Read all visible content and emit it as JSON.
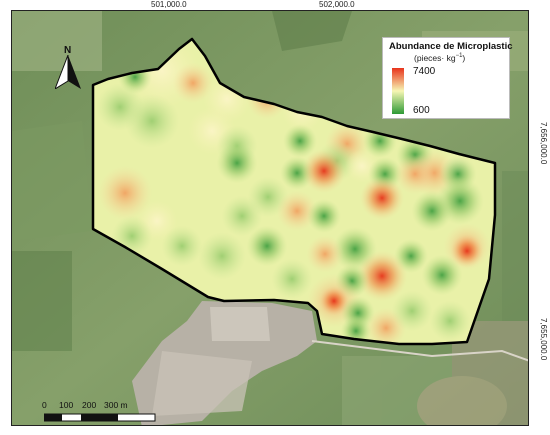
{
  "map": {
    "coordinates": {
      "easting_1": "501,000.0",
      "easting_2": "502,000.0",
      "northing_1": "7,656,000.0",
      "northing_2": "7,655,000.0"
    },
    "legend": {
      "title": "Abundance de Microplastic",
      "units_prefix": "(pieces· kg",
      "units_exp": "−1",
      "units_suffix": ")",
      "max_label": "7400",
      "min_label": "600",
      "color_high": "#e8331c",
      "color_mid": "#f6f6b4",
      "color_low": "#2e9a36"
    },
    "north_arrow": {
      "letter": "N"
    },
    "scale_bar": {
      "labels": [
        "0",
        "100",
        "200",
        "300 m"
      ]
    },
    "colors": {
      "base_fill": "#e8f0a6",
      "boundary": "#000000",
      "satellite_green": "#7d9a63",
      "urban": "#b9b3a8"
    }
  }
}
